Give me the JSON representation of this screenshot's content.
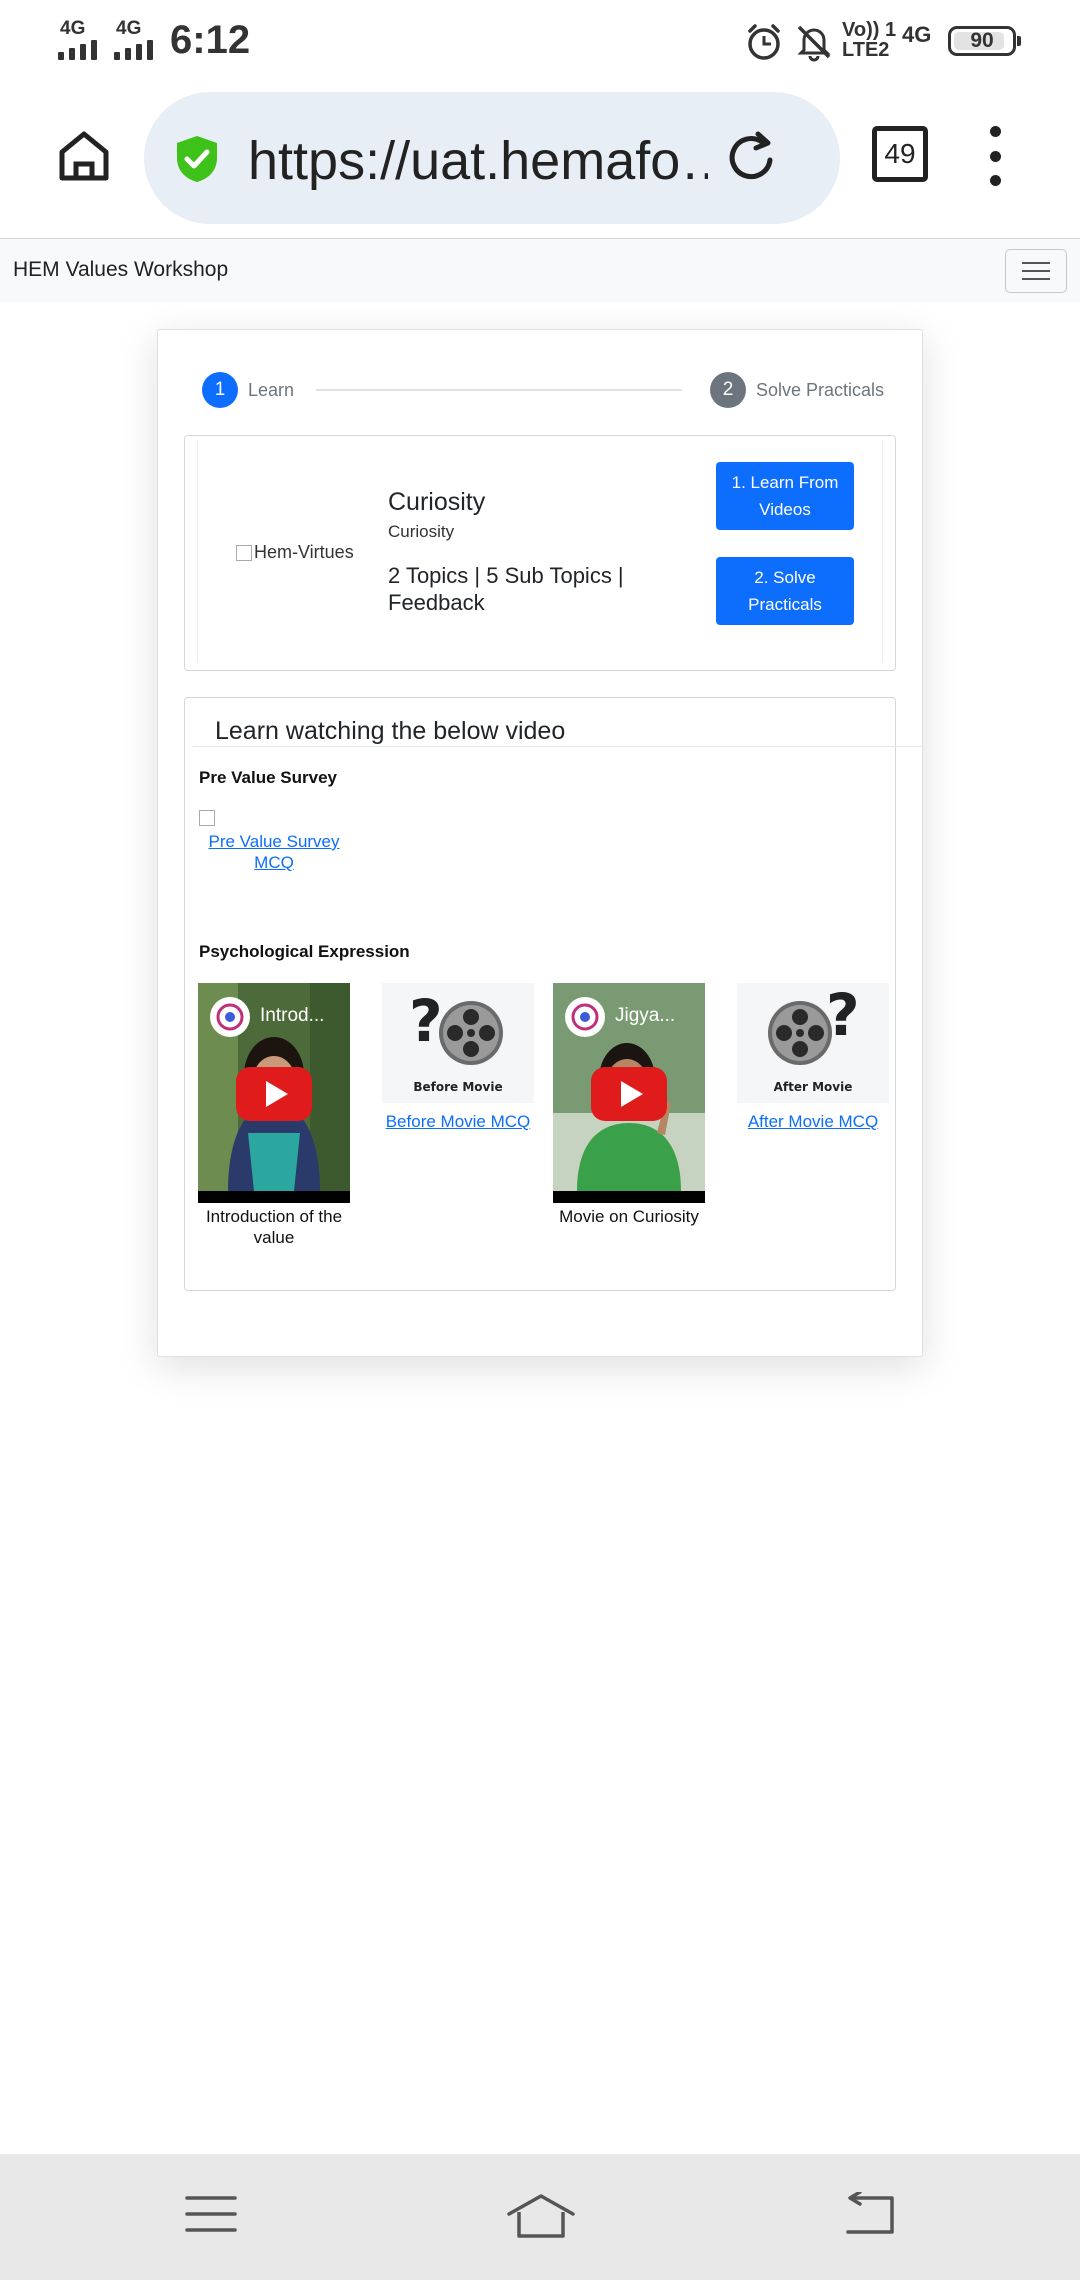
{
  "status_bar": {
    "sim1": "4G",
    "sim2": "4G",
    "time": "6:12",
    "volte_line1": "Vo)) 1",
    "volte_line2": "LTE2",
    "network": "4G",
    "battery": "90",
    "icons": [
      "alarm-icon",
      "mute-bell-icon"
    ]
  },
  "browser": {
    "url": "https://uat.hemafo…",
    "tab_count": "49",
    "secure_icon": "shield-check-icon",
    "accent_color": "#3ec21a"
  },
  "navbar": {
    "brand": "HEM Values Workshop"
  },
  "stepper": {
    "step1_number": "1",
    "step1_label": "Learn",
    "step2_number": "2",
    "step2_label": "Solve Practicals"
  },
  "course": {
    "image_alt": "Hem-Virtues",
    "title": "Curiosity",
    "subtitle": "Curiosity",
    "meta": "2 Topics | 5 Sub Topics | Feedback",
    "learn_button": "1. Learn From Videos",
    "solve_button": "2. Solve Practicals"
  },
  "video_section": {
    "heading": "Learn watching the below video",
    "pre_survey_label": "Pre Value Survey",
    "pre_survey_link": "Pre Value Survey MCQ",
    "psych_label": "Psychological Expression",
    "items": [
      {
        "title": "Introd...",
        "caption": "Introduction of the value"
      },
      {
        "image_caption": "Before Movie",
        "link": "Before Movie MCQ"
      },
      {
        "title": "Jigya...",
        "caption": "Movie on Curiosity"
      },
      {
        "image_caption": "After Movie",
        "link": "After Movie MCQ"
      }
    ]
  },
  "colors": {
    "primary": "#0d6efd",
    "secondary": "#6c757d",
    "youtube_red": "#e01b1b"
  }
}
